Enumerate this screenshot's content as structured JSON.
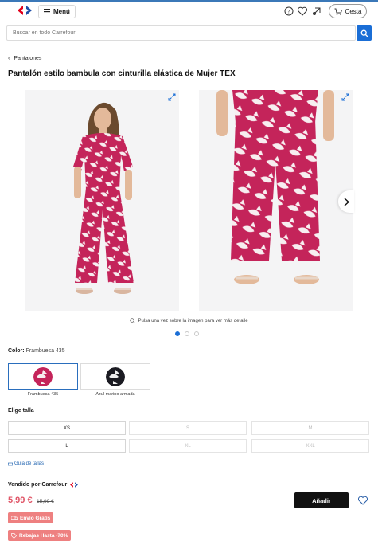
{
  "header": {
    "menu_label": "Menú",
    "cart_label": "Cesta",
    "icons": [
      "carrefour-logo",
      "chat-icon",
      "heart-icon",
      "coupon-icon",
      "cart-icon"
    ]
  },
  "search": {
    "placeholder": "Buscar en todo Carrefour"
  },
  "breadcrumb": {
    "label": "Pantalones"
  },
  "product": {
    "title": "Pantalón estilo bambula con cinturilla elástica de Mujer TEX",
    "zoom_hint": "Pulsa una vez sobre la imagen para ver más detalle",
    "color_label": "Color:",
    "color_value": "Frambuesa 435",
    "colors": [
      {
        "name": "Frambuesa 435",
        "selected": true
      },
      {
        "name": "Azul marino armada",
        "selected": false
      }
    ],
    "size_label": "Elige talla",
    "sizes": [
      {
        "label": "XS",
        "available": true
      },
      {
        "label": "S",
        "available": false
      },
      {
        "label": "M",
        "available": false
      },
      {
        "label": "L",
        "available": true
      },
      {
        "label": "XL",
        "available": false
      },
      {
        "label": "XXL",
        "available": false
      }
    ],
    "size_guide": "Guía de tallas",
    "sold_by": "Vendido por Carrefour",
    "price": "5,99 €",
    "old_price": "15,99 €",
    "add_label": "Añadir",
    "badges": [
      "Envío Gratis",
      "Rebajas Hasta -70%"
    ]
  },
  "carousel": {
    "pages": 3,
    "active": 1
  },
  "colors": {
    "accent": "#1a6ed6",
    "price": "#e05567",
    "badge": "#ee8080",
    "print": "#c4245a"
  }
}
